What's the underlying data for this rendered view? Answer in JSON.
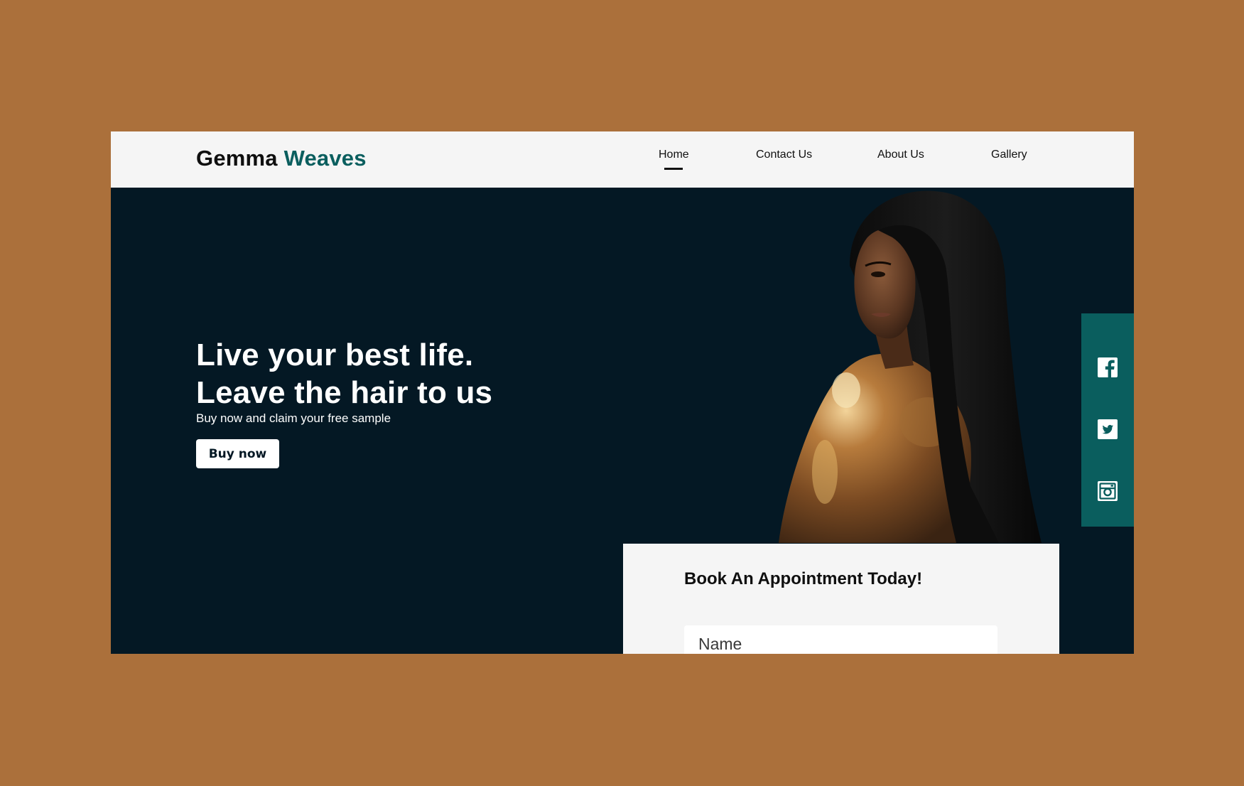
{
  "header": {
    "logo_primary": "Gemma",
    "logo_accent": "Weaves",
    "nav": [
      {
        "label": "Home",
        "active": true
      },
      {
        "label": "Contact Us",
        "active": false
      },
      {
        "label": "About Us",
        "active": false
      },
      {
        "label": "Gallery",
        "active": false
      }
    ]
  },
  "hero": {
    "headline_line1": "Live your best life.",
    "headline_line2": "Leave the hair to us",
    "subtext": "Buy now and claim your free sample",
    "cta_label": "Buy now"
  },
  "social": {
    "icons": [
      "facebook-icon",
      "twitter-icon",
      "instagram-icon"
    ]
  },
  "booking": {
    "title": "Book An Appointment Today!",
    "name_placeholder": "Name"
  },
  "colors": {
    "page_background": "#ab703b",
    "hero_background": "#041824",
    "header_background": "#f5f5f5",
    "accent_teal": "#0a5e5e",
    "card_background": "#f5f5f5"
  }
}
